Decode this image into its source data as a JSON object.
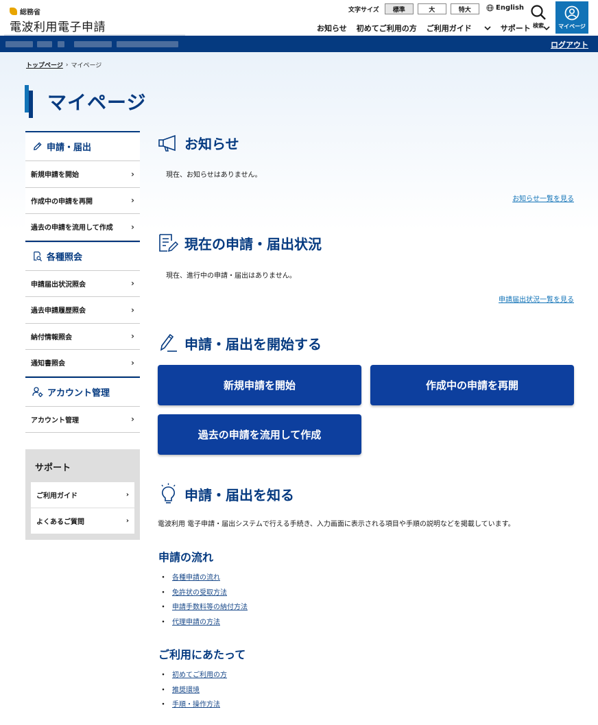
{
  "header": {
    "ministry": "総務省",
    "site_name": "電波利用電子申請",
    "font_size_label": "文字サイズ",
    "font_sizes": [
      "標準",
      "大",
      "特大"
    ],
    "english": "English",
    "nav": [
      "お知らせ",
      "初めてご利用の方",
      "ご利用ガイド",
      "サポート"
    ],
    "search_label": "検索",
    "mypage_label": "マイページ",
    "logout": "ログアウト"
  },
  "breadcrumb": {
    "home": "トップページ",
    "current": "マイページ"
  },
  "page_title": "マイページ",
  "sidebar": {
    "groups": [
      {
        "title": "申請・届出",
        "items": [
          "新規申請を開始",
          "作成中の申請を再開",
          "過去の申請を流用して作成"
        ]
      },
      {
        "title": "各種照会",
        "items": [
          "申請届出状況照会",
          "過去申請履歴照会",
          "納付情報照会",
          "通知書照会"
        ]
      },
      {
        "title": "アカウント管理",
        "items": [
          "アカウント管理"
        ]
      }
    ],
    "support": {
      "title": "サポート",
      "items": [
        "ご利用ガイド",
        "よくあるご質問"
      ]
    }
  },
  "notices": {
    "title": "お知らせ",
    "text": "現在、お知らせはありません。",
    "link": "お知らせ一覧を見る"
  },
  "status": {
    "title": "現在の申請・届出状況",
    "text": "現在、進行中の申請・届出はありません。",
    "link": "申請届出状況一覧を見る"
  },
  "start": {
    "title": "申請・届出を開始する",
    "buttons": [
      "新規申請を開始",
      "作成中の申請を再開",
      "過去の申請を流用して作成"
    ]
  },
  "learn": {
    "title": "申請・届出を知る",
    "text": "電波利用 電子申請・届出システムで行える手続き、入力画面に表示される項目や手順の説明などを掲載しています。",
    "flow_title": "申請の流れ",
    "flow_links": [
      "各種申請の流れ",
      "免許状の受取方法",
      "申請手数料等の納付方法",
      "代理申請の方法"
    ],
    "usage_title": "ご利用にあたって",
    "usage_links": [
      "初めてご利用の方",
      "推奨環境",
      "手順・操作方法"
    ]
  }
}
